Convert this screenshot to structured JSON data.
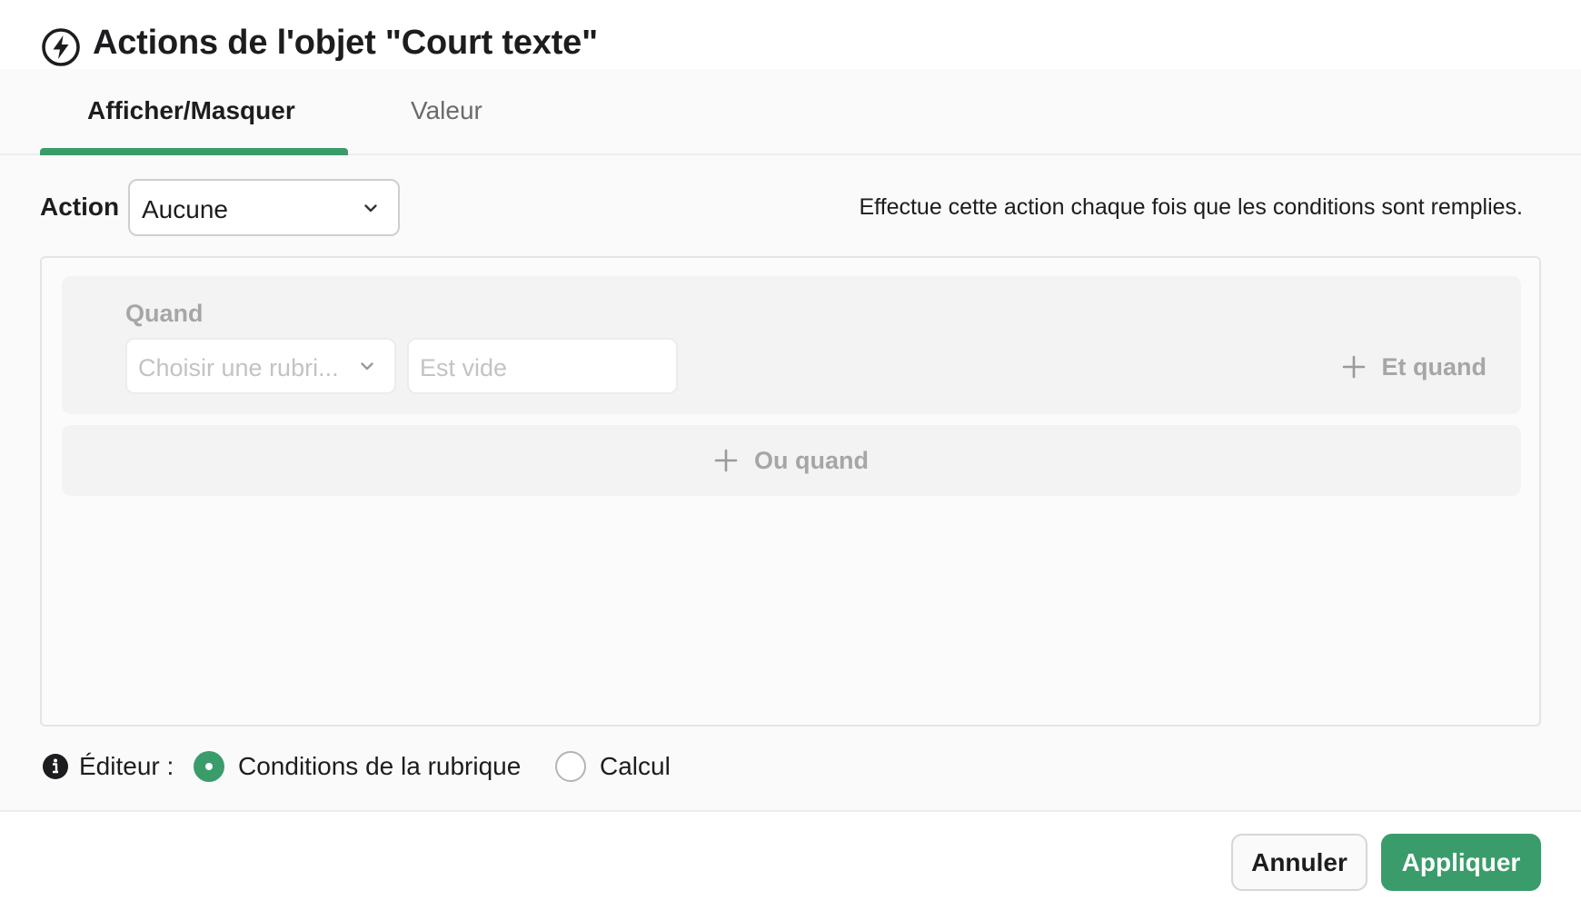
{
  "dialog": {
    "title": "Actions de l'objet \"Court texte\"",
    "title_icon": "bolt-circle-icon"
  },
  "tabs": [
    {
      "label": "Afficher/Masquer",
      "active": true
    },
    {
      "label": "Valeur",
      "active": false
    }
  ],
  "action": {
    "label": "Action",
    "value": "Aucune",
    "help_text": "Effectue cette action chaque fois que les conditions sont remplies."
  },
  "conditions": {
    "when_label": "Quand",
    "field_placeholder": "Choisir une rubri...",
    "operator_placeholder": "Est vide",
    "and_when_label": "Et quand",
    "or_when_label": "Ou quand"
  },
  "editor": {
    "label": "Éditeur :",
    "options": [
      {
        "label": "Conditions de la rubrique",
        "selected": true
      },
      {
        "label": "Calcul",
        "selected": false
      }
    ]
  },
  "footer": {
    "cancel_label": "Annuler",
    "apply_label": "Appliquer"
  },
  "colors": {
    "accent": "#3a9c6a",
    "muted_text": "#a6a6a6",
    "text": "#1d1d1f"
  }
}
